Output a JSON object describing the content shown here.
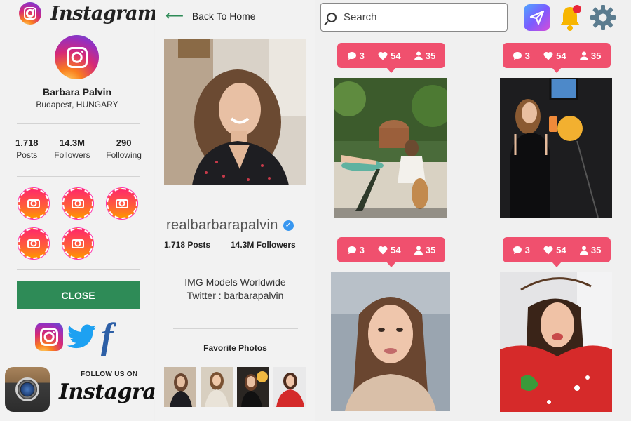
{
  "brand": {
    "name": "Instagram"
  },
  "profile": {
    "name": "Barbara Palvin",
    "location": "Budapest, HUNGARY",
    "stats": [
      {
        "value": "1.718",
        "label": "Posts"
      },
      {
        "value": "14.3M",
        "label": "Followers"
      },
      {
        "value": "290",
        "label": "Following"
      }
    ],
    "close_label": "CLOSE"
  },
  "follow": {
    "small": "FOLLOW US ON",
    "big": "Instagram"
  },
  "detail": {
    "back_label": "Back To Home",
    "username": "realbarbarapalvin",
    "posts": "1.718 Posts",
    "followers": "14.3M Followers",
    "bio_line1": "IMG Models Worldwide",
    "bio_line2": "Twitter : barbarapalvin",
    "favorites_title": "Favorite Photos"
  },
  "search": {
    "placeholder": "Search"
  },
  "feed": [
    {
      "comments": "3",
      "likes": "54",
      "followers": "35"
    },
    {
      "comments": "3",
      "likes": "54",
      "followers": "35"
    },
    {
      "comments": "3",
      "likes": "54",
      "followers": "35"
    },
    {
      "comments": "3",
      "likes": "54",
      "followers": "35"
    }
  ],
  "colors": {
    "accent_green": "#2e8b57",
    "bubble_red": "#f0506e",
    "verified_blue": "#3897f0",
    "facebook_blue": "#2d5fa6",
    "twitter_blue": "#1da1f2"
  }
}
